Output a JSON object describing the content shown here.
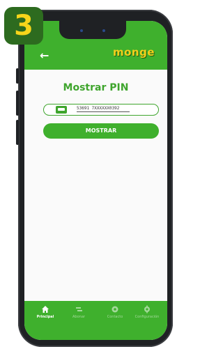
{
  "step": {
    "number": "3"
  },
  "header": {
    "back_symbol": "←",
    "logo": "monge"
  },
  "main": {
    "title": "Mostrar PIN",
    "card_field": {
      "value": "53691 7XXXXXX0392"
    },
    "button_label": "MOSTRAR"
  },
  "nav": {
    "items": [
      {
        "label": "Principal",
        "icon": "home-icon",
        "active": true
      },
      {
        "label": "Abonar",
        "icon": "transfer-icon",
        "active": false
      },
      {
        "label": "Contacto",
        "icon": "chat-icon",
        "active": false
      },
      {
        "label": "Configuración",
        "icon": "gear-icon",
        "active": false
      }
    ]
  },
  "colors": {
    "brand_green": "#3fb02d",
    "badge_green": "#2d6b1f",
    "badge_digit": "#f7d51a",
    "logo_yellow": "#f4cf1b"
  }
}
